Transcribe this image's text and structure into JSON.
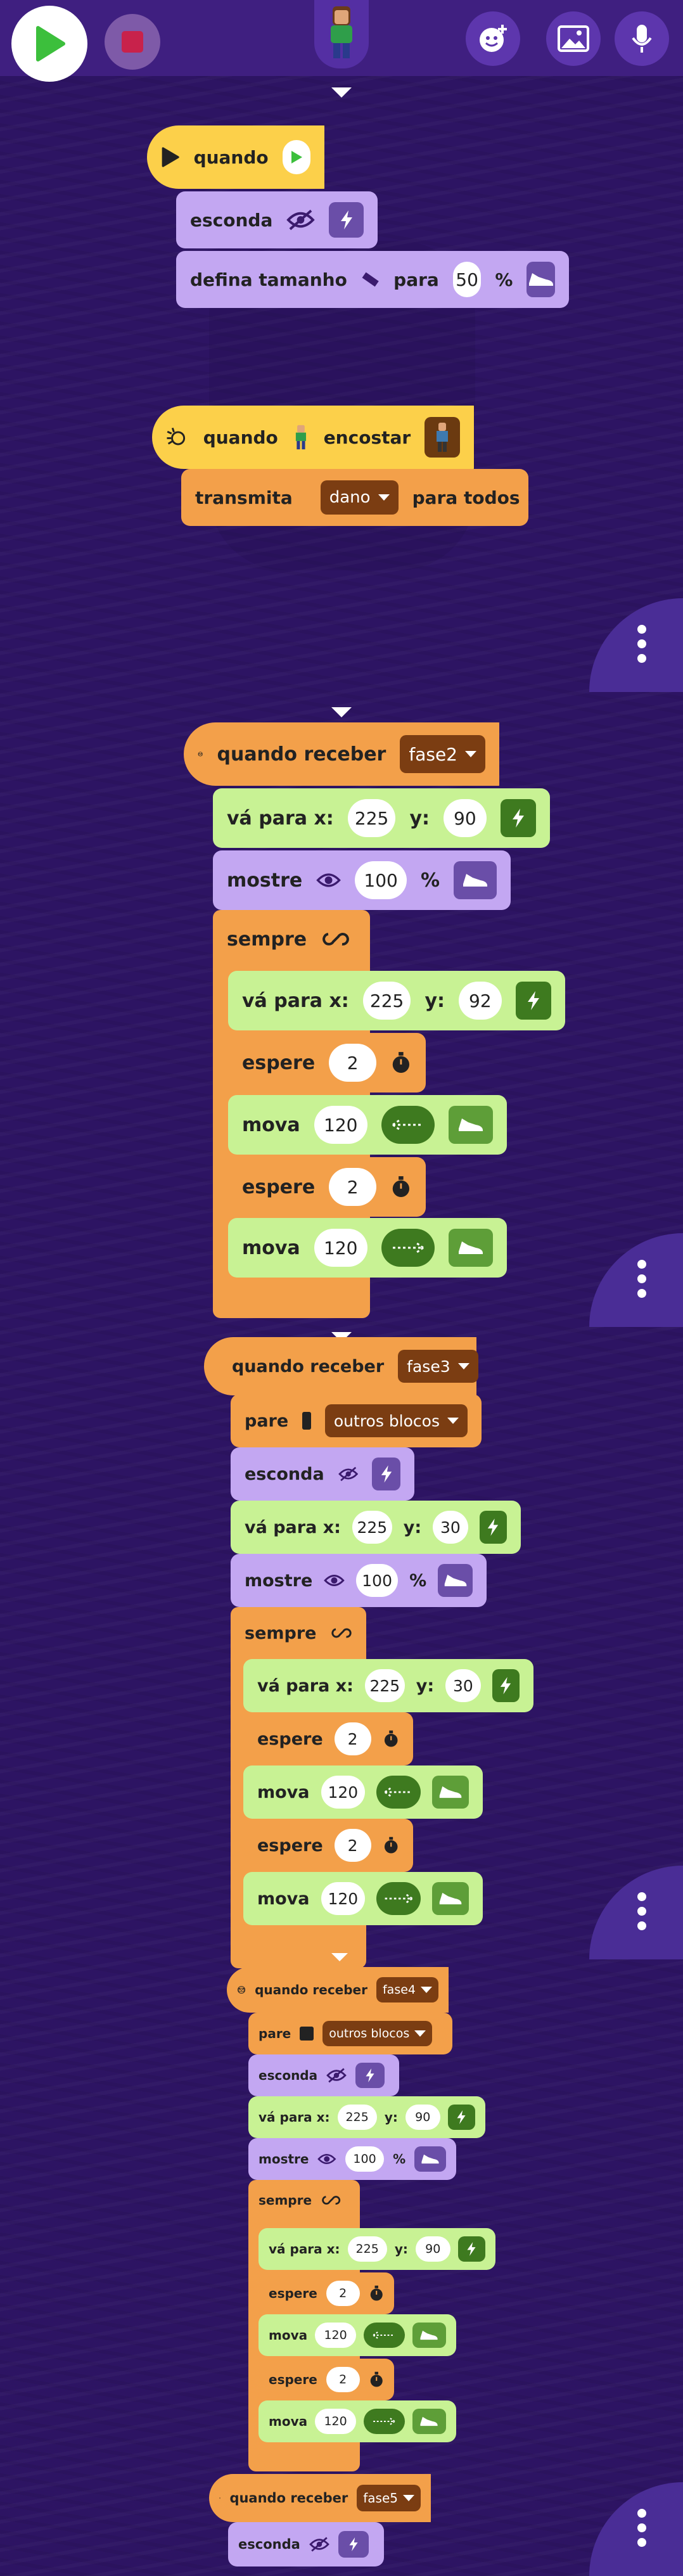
{
  "toolbar": {
    "play_icon": "play-icon",
    "stop_icon": "stop-icon",
    "add_sprite_icon": "add-character-icon",
    "backgrounds_icon": "image-icon",
    "sound_icon": "microphone-icon"
  },
  "script1": {
    "hat": "quando",
    "esconda": "esconda",
    "defina": "defina tamanho",
    "para": "para",
    "size_value": "50",
    "percent": "%"
  },
  "script2": {
    "hat": "quando",
    "encostar": "encostar",
    "transmita": "transmita",
    "message": "dano",
    "para_todos": "para todos"
  },
  "script3": {
    "hat": "quando receber",
    "message": "fase2",
    "va_para": "vá para x:",
    "x": "225",
    "y_label": "y:",
    "y": "90",
    "mostre": "mostre",
    "mostre_value": "100",
    "percent": "%",
    "sempre": "sempre",
    "inner_va": "vá para x:",
    "inner_x": "225",
    "inner_y_label": "y:",
    "inner_y": "92",
    "espere1": "espere",
    "espere1_value": "2",
    "mova1": "mova",
    "mova1_value": "120",
    "espere2": "espere",
    "espere2_value": "2",
    "mova2": "mova",
    "mova2_value": "120"
  },
  "script4": {
    "hat": "quando receber",
    "message": "fase3",
    "pare": "pare",
    "pare_option": "outros blocos",
    "esconda": "esconda",
    "va_para": "vá para x:",
    "x": "225",
    "y_label": "y:",
    "y": "30",
    "mostre": "mostre",
    "mostre_value": "100",
    "percent": "%",
    "sempre": "sempre",
    "inner_va": "vá para x:",
    "inner_x": "225",
    "inner_y_label": "y:",
    "inner_y": "30",
    "espere1": "espere",
    "espere1_value": "2",
    "mova1": "mova",
    "mova1_value": "120",
    "espere2": "espere",
    "espere2_value": "2",
    "mova2": "mova",
    "mova2_value": "120"
  },
  "script5": {
    "hat": "quando receber",
    "message": "fase4",
    "pare": "pare",
    "pare_option": "outros blocos",
    "esconda": "esconda",
    "va_para": "vá para x:",
    "x": "225",
    "y_label": "y:",
    "y": "90",
    "mostre": "mostre",
    "mostre_value": "100",
    "percent": "%",
    "sempre": "sempre",
    "inner_va": "vá para x:",
    "inner_x": "225",
    "inner_y_label": "y:",
    "inner_y": "90",
    "espere1": "espere",
    "espere1_value": "2",
    "mova1": "mova",
    "mova1_value": "120",
    "espere2": "espere",
    "espere2_value": "2",
    "mova2": "mova",
    "mova2_value": "120"
  },
  "script6": {
    "hat": "quando receber",
    "message": "fase5",
    "esconda": "esconda"
  },
  "colors": {
    "background": "#2d1463",
    "event_yellow": "#fcd04a",
    "looks_purple": "#c3a7f2",
    "control_orange": "#f3a04a",
    "motion_green": "#c8f294"
  }
}
